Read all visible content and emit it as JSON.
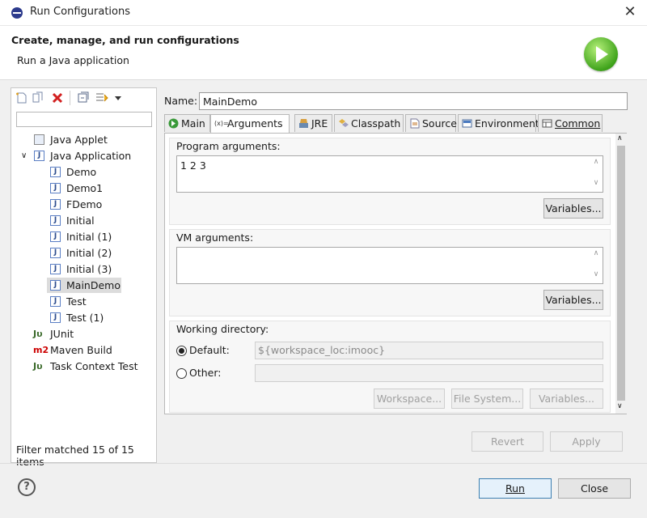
{
  "window": {
    "title": "Run Configurations",
    "close_glyph": "✕"
  },
  "header": {
    "title": "Create, manage, and run configurations",
    "subtitle": "Run a Java application",
    "badge_icon": "run-green-icon"
  },
  "toolbar": {
    "icons": [
      "new-config-icon",
      "duplicate-icon",
      "delete-icon",
      "collapse-all-icon",
      "filter-icon",
      "view-menu-icon"
    ]
  },
  "filter": {
    "value": "",
    "placeholder": ""
  },
  "tree": {
    "java_applet": "Java Applet",
    "java_application": "Java Application",
    "children": [
      "Demo",
      "Demo1",
      "FDemo",
      "Initial",
      "Initial (1)",
      "Initial (2)",
      "Initial (3)",
      "MainDemo",
      "Test",
      "Test (1)"
    ],
    "selected": "MainDemo",
    "junit": "JUnit",
    "maven": "Maven Build",
    "task_context": "Task Context Test"
  },
  "filter_status": "Filter matched 15 of 15 items",
  "name": {
    "label": "Name:",
    "value": "MainDemo"
  },
  "tabs": [
    "Main",
    "Arguments",
    "JRE",
    "Classpath",
    "Source",
    "Environment",
    "Common"
  ],
  "active_tab": "Arguments",
  "arguments": {
    "program_label": "Program arguments:",
    "program_value": "1 2 3",
    "variables_label": "Variables...",
    "vm_label": "VM arguments:",
    "vm_value": "",
    "working_dir_label": "Working directory:",
    "default_label": "Default:",
    "default_value": "${workspace_loc:imooc}",
    "other_label": "Other:",
    "other_value": "",
    "workspace_btn": "Workspace...",
    "filesystem_btn": "File System...",
    "variables_btn": "Variables..."
  },
  "footer": {
    "revert": "Revert",
    "apply": "Apply",
    "run": "Run",
    "close": "Close",
    "help_glyph": "?"
  }
}
